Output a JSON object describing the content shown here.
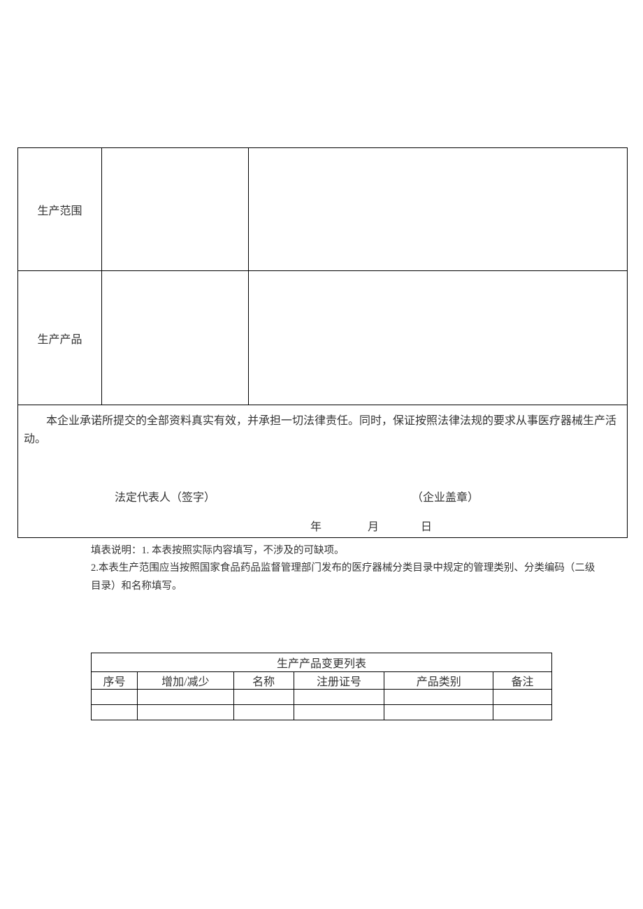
{
  "main_table": {
    "scope_label": "生产范围",
    "scope_col2": "",
    "scope_col3": "",
    "product_label": "生产产品",
    "product_col2": "",
    "product_col3": "",
    "commitment_text": "本企业承诺所提交的全部资料真实有效，并承担一切法律责任。同时，保证按照法律法规的要求从事医疗器械生产活动。",
    "legal_rep_label": "法定代表人（签字）",
    "stamp_label": "（企业盖章）",
    "date_year": "年",
    "date_month": "月",
    "date_day": "日"
  },
  "notes": {
    "line1": "填表说明：1. 本表按照实际内容填写，不涉及的可缺项。",
    "line2": "2.本表生产范围应当按照国家食品药品监督管理部门发布的医疗器械分类目录中规定的管理类别、分类编码（二级目录）和名称填写。"
  },
  "change_table": {
    "title": "生产产品变更列表",
    "headers": {
      "seq": "序号",
      "change": "增加/减少",
      "name": "名称",
      "cert": "注册证号",
      "category": "产品类别",
      "remark": "备注"
    },
    "rows": [
      {
        "seq": "",
        "change": "",
        "name": "",
        "cert": "",
        "category": "",
        "remark": ""
      },
      {
        "seq": "",
        "change": "",
        "name": "",
        "cert": "",
        "category": "",
        "remark": ""
      }
    ]
  }
}
